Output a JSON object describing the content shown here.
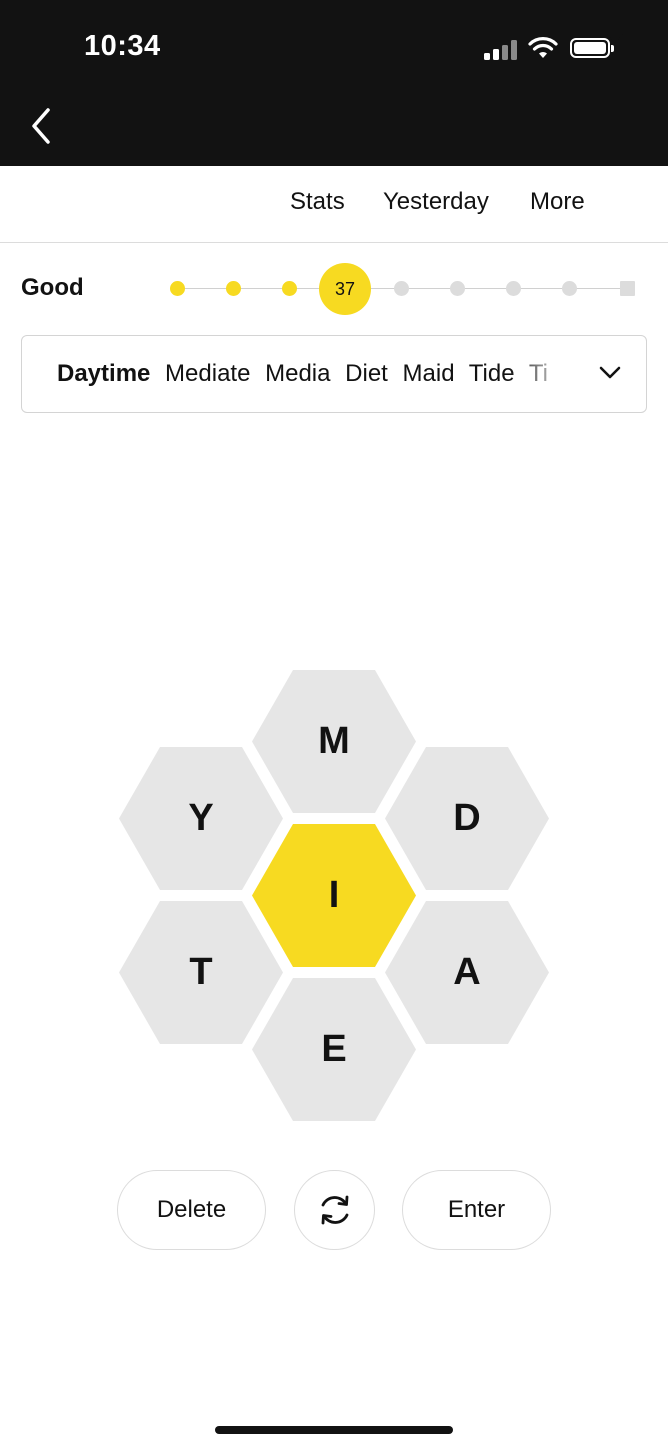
{
  "status_bar": {
    "time": "10:34"
  },
  "nav": {
    "stats": "Stats",
    "yesterday": "Yesterday",
    "more": "More"
  },
  "progress": {
    "rank": "Good",
    "score": "37",
    "levels_total": 9,
    "levels_reached": 4
  },
  "word_list": {
    "words": [
      "Daytime",
      "Mediate",
      "Media",
      "Diet",
      "Maid",
      "Tide",
      "Ti"
    ]
  },
  "hive": {
    "center_letter": "I",
    "outer_letters": [
      "M",
      "D",
      "A",
      "E",
      "T",
      "Y"
    ]
  },
  "buttons": {
    "delete": "Delete",
    "enter": "Enter"
  },
  "colors": {
    "accent": "#f7da21",
    "cell": "#e6e6e6",
    "header": "#121212"
  }
}
